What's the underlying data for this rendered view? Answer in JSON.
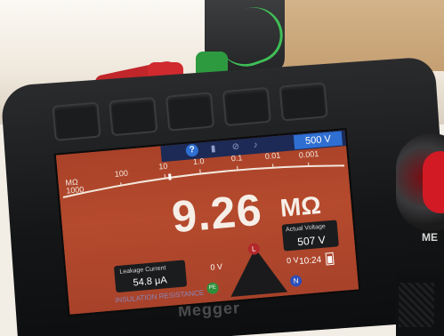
{
  "device": {
    "brand": "Megger",
    "model_partial": "ME"
  },
  "screen": {
    "test_voltage": "500 V",
    "scale": {
      "range_label_top": "MΩ",
      "range_label_bottom": "1000",
      "ticks": [
        "100",
        "10",
        "1.0",
        "0.1",
        "0.01",
        "0.001"
      ]
    },
    "reading_value": "9.26",
    "reading_unit": "MΩ",
    "actual_voltage_label": "Actual Voltage",
    "actual_voltage_value": "507 V",
    "leakage_current_label": "Leakage Current",
    "leakage_current_value": "54.8 μA",
    "mode_label": "INSULATION RESISTANCE",
    "time": "10:24",
    "diagram": {
      "voltage_left": "0 V",
      "voltage_right": "0 V",
      "node_l": "L",
      "node_pe": "PE",
      "node_n": "N"
    }
  },
  "colors": {
    "screen_bg": "#b54a2d",
    "status_bar": "#1c2a55",
    "voltage_badge": "#2f6fd2",
    "lead_red": "#c0262a",
    "lead_green": "#2d9a3f"
  }
}
